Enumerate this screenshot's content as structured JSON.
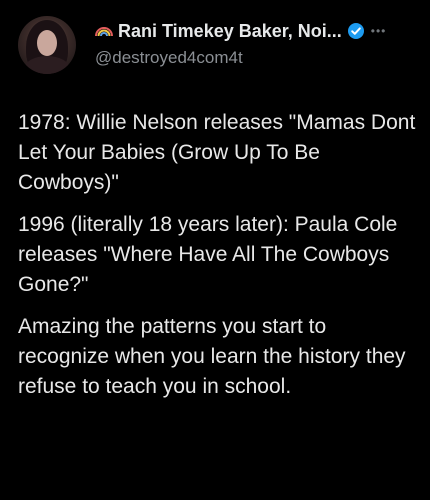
{
  "author": {
    "display_name": "Rani Timekey Baker, Noi...",
    "handle": "@destroyed4com4t",
    "verified_color": "#1d9bf0",
    "avatar_icon": "profile-photo",
    "name_emoji_icon": "rainbow-emoji-icon",
    "more_icon": "more-options-icon"
  },
  "tweet": {
    "paragraphs": [
      "1978: Willie Nelson releases \"Mamas Dont Let Your Babies (Grow Up To Be Cowboys)\"",
      "1996 (literally 18 years later): Paula Cole releases \"Where Have All The Cowboys Gone?\"",
      "Amazing the patterns you start to recognize when you learn the history they refuse to teach you in school."
    ]
  },
  "colors": {
    "background": "#000000",
    "text_primary": "#e7e9ea",
    "text_secondary": "#8b8f94",
    "verified_blue": "#1d9bf0"
  }
}
